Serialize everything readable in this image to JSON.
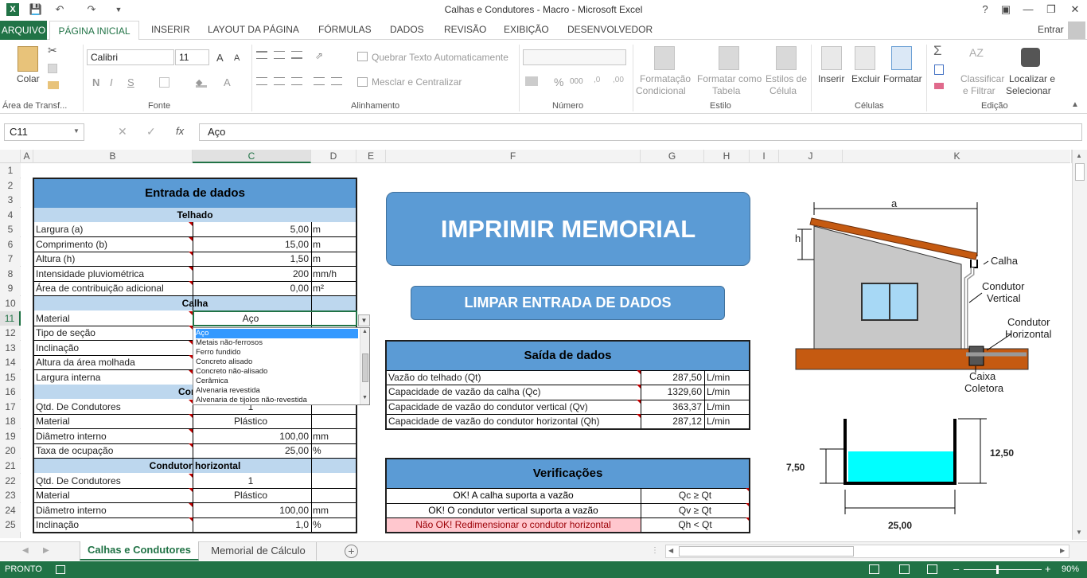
{
  "window": {
    "title": "Calhas e Condutores - Macro - Microsoft Excel",
    "help": "?",
    "signin": "Entrar"
  },
  "tabs": [
    "ARQUIVO",
    "PÁGINA INICIAL",
    "INSERIR",
    "LAYOUT DA PÁGINA",
    "FÓRMULAS",
    "DADOS",
    "REVISÃO",
    "EXIBIÇÃO",
    "DESENVOLVEDOR"
  ],
  "ribbon": {
    "paste": "Colar",
    "clipboard": "Área de Transf...",
    "font_name": "Calibri",
    "font_size": "11",
    "font_group": "Fonte",
    "bold": "N",
    "italic": "I",
    "underline": "S",
    "wrap": "Quebrar Texto Automaticamente",
    "merge": "Mesclar e Centralizar",
    "align_group": "Alinhamento",
    "number_group": "Número",
    "percent": "%",
    "thousands": "000",
    "cond_format_1": "Formatação",
    "cond_format_2": "Condicional",
    "fmt_table_1": "Formatar como",
    "fmt_table_2": "Tabela",
    "cell_styles_1": "Estilos de",
    "cell_styles_2": "Célula",
    "styles_group": "Estilo",
    "insert": "Inserir",
    "delete": "Excluir",
    "format": "Formatar",
    "cells_group": "Células",
    "sort_1": "Classificar",
    "sort_2": "e Filtrar",
    "find_1": "Localizar e",
    "find_2": "Selecionar",
    "edit_group": "Edição"
  },
  "formula_bar": {
    "name_box": "C11",
    "fx": "fx",
    "value": "Aço"
  },
  "columns": [
    "A",
    "B",
    "C",
    "D",
    "E",
    "F",
    "G",
    "H",
    "I",
    "J",
    "K"
  ],
  "rows": [
    "1",
    "2",
    "3",
    "4",
    "5",
    "6",
    "7",
    "8",
    "9",
    "10",
    "11",
    "12",
    "13",
    "14",
    "15",
    "16",
    "17",
    "18",
    "19",
    "20",
    "21",
    "22",
    "23",
    "24",
    "25"
  ],
  "input": {
    "title": "Entrada de dados",
    "telhado": "Telhado",
    "t_rows": [
      {
        "label": "Largura (a)",
        "value": "5,00",
        "unit": "m"
      },
      {
        "label": "Comprimento (b)",
        "value": "15,00",
        "unit": "m"
      },
      {
        "label": "Altura (h)",
        "value": "1,50",
        "unit": "m"
      },
      {
        "label": "Intensidade pluviométrica",
        "value": "200",
        "unit": "mm/h"
      },
      {
        "label": "Área de contribuição adicional",
        "value": "0,00",
        "unit": "m²"
      }
    ],
    "calha": "Calha",
    "c_rows": [
      {
        "label": "Material",
        "value": "Aço",
        "unit": ""
      },
      {
        "label": "Tipo de seção",
        "value": "",
        "unit": ""
      },
      {
        "label": "Inclinação",
        "value": "",
        "unit": ""
      },
      {
        "label": "Altura da área molhada",
        "value": "",
        "unit": ""
      },
      {
        "label": "Largura interna",
        "value": "",
        "unit": ""
      }
    ],
    "cond_v": "Condut",
    "v_rows": [
      {
        "label": "Qtd. De Condutores",
        "value": "1",
        "unit": ""
      },
      {
        "label": "Material",
        "value": "Plástico",
        "unit": ""
      },
      {
        "label": "Diâmetro interno",
        "value": "100,00",
        "unit": "mm"
      },
      {
        "label": "Taxa de ocupação",
        "value": "25,00",
        "unit": "%"
      }
    ],
    "cond_h": "Condutor horizontal",
    "h_rows": [
      {
        "label": "Qtd. De Condutores",
        "value": "1",
        "unit": ""
      },
      {
        "label": "Material",
        "value": "Plástico",
        "unit": ""
      },
      {
        "label": "Diâmetro interno",
        "value": "100,00",
        "unit": "mm"
      },
      {
        "label": "Inclinação",
        "value": "1,0",
        "unit": "%"
      }
    ]
  },
  "dropdown": {
    "items": [
      "Aço",
      "Metais não-ferrosos",
      "Ferro fundido",
      "Concreto alisado",
      "Concreto não-alisado",
      "Cerâmica",
      "Alvenaria revestida",
      "Alvenaria de tijolos não-revestida"
    ],
    "selected": 0
  },
  "buttons": {
    "print": "IMPRIMIR MEMORIAL",
    "clear": "LIMPAR ENTRADA DE DADOS"
  },
  "output": {
    "title": "Saída de dados",
    "rows": [
      {
        "label": "Vazão do telhado (Qt)",
        "value": "287,50",
        "unit": "L/min"
      },
      {
        "label": "Capacidade de vazão da calha (Qc)",
        "value": "1329,60",
        "unit": "L/min"
      },
      {
        "label": "Capacidade de vazão do condutor vertical (Qv)",
        "value": "363,37",
        "unit": "L/min"
      },
      {
        "label": "Capacidade de vazão do condutor horizontal (Qh)",
        "value": "287,12",
        "unit": "L/min"
      }
    ]
  },
  "checks": {
    "title": "Verificações",
    "rows": [
      {
        "msg": "OK! A calha suporta a vazão",
        "cond": "Qc ≥ Qt",
        "ok": true
      },
      {
        "msg": "OK! O condutor vertical suporta a vazão",
        "cond": "Qv ≥ Qt",
        "ok": true
      },
      {
        "msg": "Não OK! Redimensionar o condutor horizontal",
        "cond": "Qh < Qt",
        "ok": false
      }
    ]
  },
  "diagram": {
    "a": "a",
    "h": "h",
    "calha": "Calha",
    "cv1": "Condutor",
    "cv2": "Vertical",
    "ch1": "Condutor",
    "ch2": "Horizontal",
    "cx1": "Caixa",
    "cx2": "Coletora"
  },
  "section": {
    "h1": "7,50",
    "h2": "12,50",
    "w": "25,00"
  },
  "sheets": [
    "Calhas e Condutores",
    "Memorial de Cálculo"
  ],
  "status": {
    "mode": "PRONTO",
    "zoom": "90%"
  },
  "colors": {
    "excel_green": "#217346",
    "header_blue": "#5b9bd5",
    "subheader_blue": "#bdd7ee",
    "fail_pink": "#ffc7ce",
    "fail_red": "#9c0006",
    "water": "#00ffff",
    "roof": "#c55a11"
  }
}
